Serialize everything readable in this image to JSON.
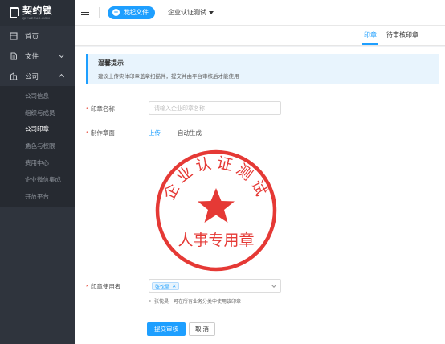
{
  "brand": {
    "name": "契约锁",
    "sub": "QIYUESUO.COM"
  },
  "topbar": {
    "send_button": "发起文件",
    "company": "企业认证测试"
  },
  "sidebar": {
    "items": [
      {
        "label": "首页",
        "icon": "home-icon"
      },
      {
        "label": "文件",
        "icon": "file-icon"
      },
      {
        "label": "公司",
        "icon": "company-icon"
      }
    ],
    "company_sub": [
      "公司信息",
      "组织与成员",
      "公司印章",
      "角色与权限",
      "费用中心",
      "企业微信集成",
      "开放平台"
    ],
    "active_sub": "公司印章"
  },
  "tabs": [
    {
      "label": "印章",
      "active": true
    },
    {
      "label": "待审核印章",
      "active": false
    }
  ],
  "notice": {
    "title": "温馨提示",
    "desc": "建议上传实体印章盖章扫描件，提交并由平台审核后才能使用"
  },
  "form": {
    "name_label": "印章名称",
    "name_placeholder": "请输入企业印章名称",
    "face_label": "制作章面",
    "upload_label": "上传",
    "auto_label": "自动生成",
    "user_label": "印章使用者",
    "selected_user": "张忱昊",
    "hint_name": "张忱昊",
    "hint_text": "可在所有业务分类中使用该印章",
    "submit_label": "提交审核",
    "cancel_label": "取 消"
  },
  "seal": {
    "arc_text": "企业认证测试",
    "bottom_text": "人事专用章",
    "color": "#e53935"
  },
  "colors": {
    "accent": "#1e9fff",
    "sidebar_bg": "#2f343d",
    "seal_red": "#e53935"
  }
}
